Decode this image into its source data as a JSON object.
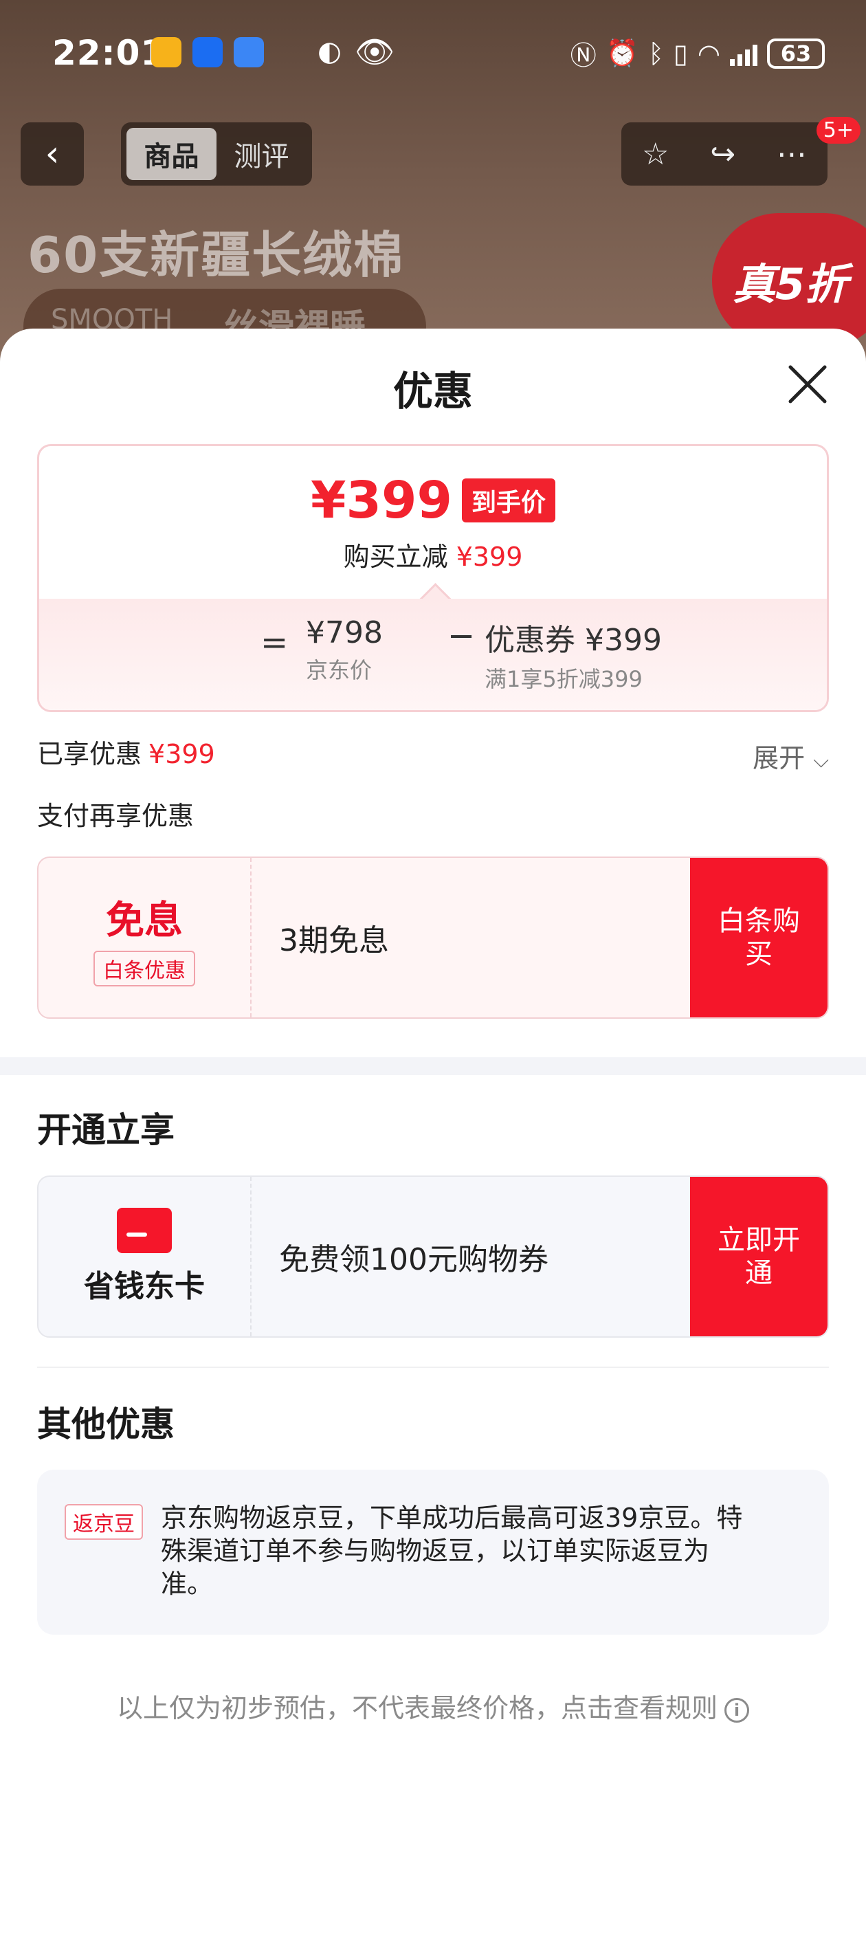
{
  "status_bar": {
    "time": "22:01",
    "battery": "63"
  },
  "nav": {
    "back": "‹",
    "tabs": [
      {
        "label": "商品"
      },
      {
        "label": "测评"
      }
    ],
    "badge": "5+"
  },
  "product": {
    "title": "60支新疆长绒棉",
    "pill_left": "SMOOTH",
    "pill_right": "丝滑裸睡",
    "promo_tag": "真5折"
  },
  "sheet": {
    "title": "优惠",
    "price_card": {
      "final_price": "¥399",
      "final_tag": "到手价",
      "sub_label": "购买立减",
      "sub_amount": "¥399",
      "equals": "=",
      "jd_price_value": "¥798",
      "jd_price_label": "京东价",
      "minus": "−",
      "coupon_value": "优惠券 ¥399",
      "coupon_label": "满1享5折减399"
    },
    "enjoyed_label": "已享优惠",
    "enjoyed_amount": "¥399",
    "expand_label": "展开",
    "pay_more_label": "支付再享优惠",
    "baitiao": {
      "big": "免息",
      "small": "白条优惠",
      "desc": "3期免息",
      "button": "白条购买"
    },
    "open_section_title": "开通立享",
    "saver_card": {
      "name": "省钱东卡",
      "desc": "免费领100元购物券",
      "button": "立即开通"
    },
    "other_section_title": "其他优惠",
    "bean": {
      "tag": "返京豆",
      "text": "京东购物返京豆，下单成功后最高可返39京豆。特殊渠道订单不参与购物返豆，以订单实际返豆为准。"
    },
    "footer_note": "以上仅为初步预估，不代表最终价格，点击查看规则"
  },
  "colors": {
    "accent": "#f2222e",
    "button_red": "#f5162a",
    "soft_bg": "#f5f6fa"
  }
}
